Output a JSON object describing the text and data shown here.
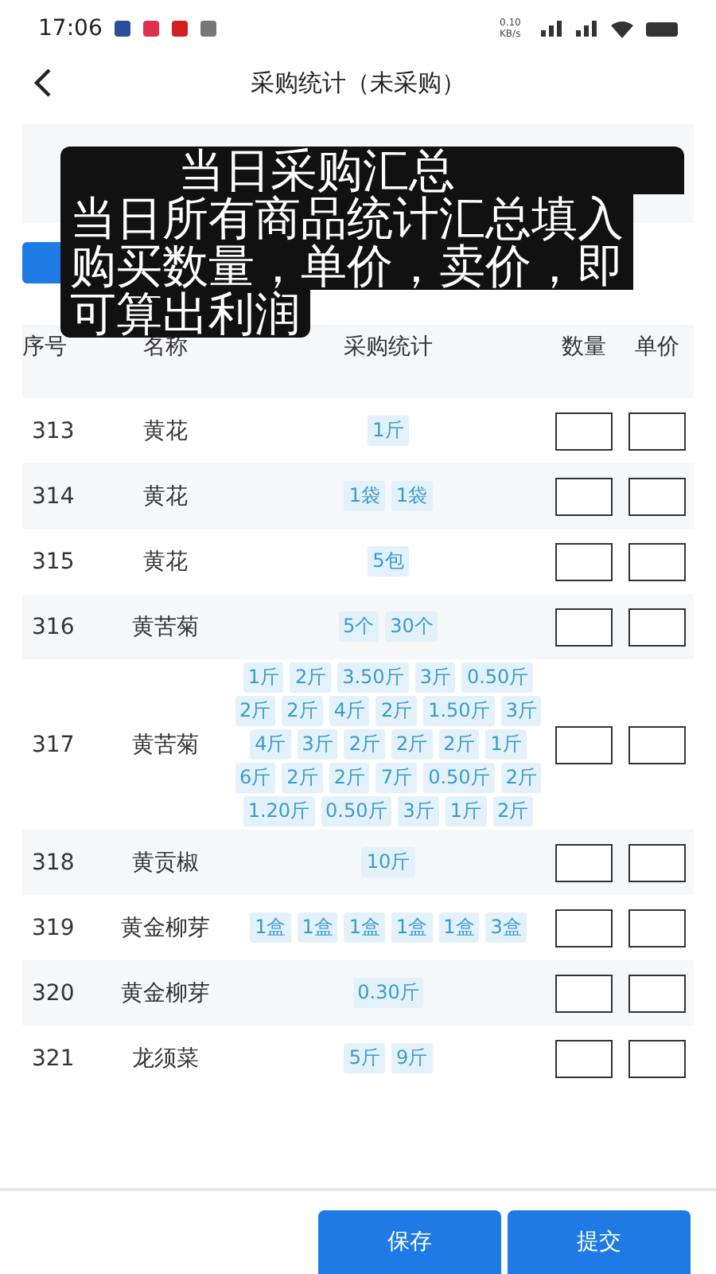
{
  "status_bar": {
    "time": "17:06",
    "net_speed": "0.10 KB/s"
  },
  "nav": {
    "title": "采购统计（未采购）"
  },
  "caption": {
    "lines": [
      "当日采购汇总",
      "当日所有商品统计汇总填入",
      "购买数量，单价，卖价，即",
      "可算出利润"
    ]
  },
  "table": {
    "columns": [
      "序号",
      "名称",
      "采购统计",
      "数量",
      "单价"
    ],
    "rows": [
      {
        "no": "313",
        "name": "黄花",
        "tags": [
          "1斤"
        ]
      },
      {
        "no": "314",
        "name": "黄花",
        "tags": [
          "1袋",
          "1袋"
        ]
      },
      {
        "no": "315",
        "name": "黄花",
        "tags": [
          "5包"
        ]
      },
      {
        "no": "316",
        "name": "黄苦菊",
        "tags": [
          "5个",
          "30个"
        ]
      },
      {
        "no": "317",
        "name": "黄苦菊",
        "tags": [
          "1斤",
          "2斤",
          "3.50斤",
          "3斤",
          "0.50斤",
          "2斤",
          "2斤",
          "4斤",
          "2斤",
          "1.50斤",
          "3斤",
          "4斤",
          "3斤",
          "2斤",
          "2斤",
          "2斤",
          "1斤",
          "6斤",
          "2斤",
          "2斤",
          "7斤",
          "0.50斤",
          "2斤",
          "1.20斤",
          "0.50斤",
          "3斤",
          "1斤",
          "2斤"
        ]
      },
      {
        "no": "318",
        "name": "黄贡椒",
        "tags": [
          "10斤"
        ]
      },
      {
        "no": "319",
        "name": "黄金柳芽",
        "tags": [
          "1盒",
          "1盒",
          "1盒",
          "1盒",
          "1盒",
          "3盒"
        ]
      },
      {
        "no": "320",
        "name": "黄金柳芽",
        "tags": [
          "0.30斤"
        ]
      },
      {
        "no": "321",
        "name": "龙须菜",
        "tags": [
          "5斤",
          "9斤"
        ]
      }
    ]
  },
  "buttons": [
    "保存",
    "提交"
  ]
}
